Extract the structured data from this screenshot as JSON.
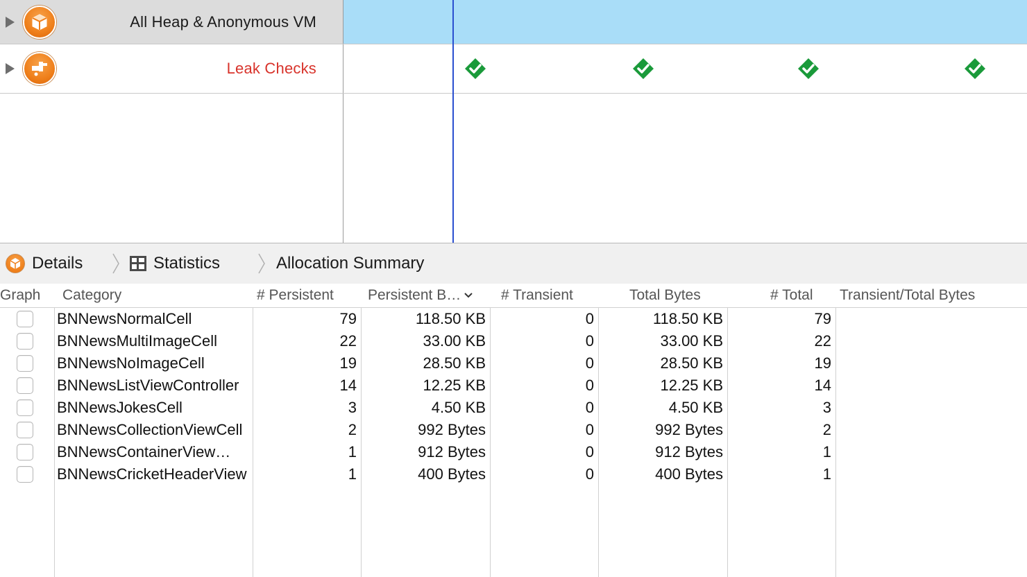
{
  "instruments": [
    {
      "name": "All Heap & Anonymous VM",
      "icon": "allocations-icon"
    },
    {
      "name": "Leak Checks",
      "icon": "leaks-icon",
      "checks": 4
    }
  ],
  "jumpbar": {
    "details": "Details",
    "statistics": "Statistics",
    "allocation_summary": "Allocation Summary"
  },
  "table": {
    "columns": {
      "graph": "Graph",
      "category": "Category",
      "persistent": "# Persistent",
      "persistent_bytes": "Persistent B…",
      "transient": "# Transient",
      "total_bytes": "Total Bytes",
      "total": "# Total",
      "transient_total_bytes": "Transient/Total Bytes"
    },
    "rows": [
      {
        "category": "BNNewsNormalCell",
        "persistent": "79",
        "persistent_bytes": "118.50 KB",
        "transient": "0",
        "total_bytes": "118.50 KB",
        "total": "79"
      },
      {
        "category": "BNNewsMultiImageCell",
        "persistent": "22",
        "persistent_bytes": "33.00 KB",
        "transient": "0",
        "total_bytes": "33.00 KB",
        "total": "22"
      },
      {
        "category": "BNNewsNoImageCell",
        "persistent": "19",
        "persistent_bytes": "28.50 KB",
        "transient": "0",
        "total_bytes": "28.50 KB",
        "total": "19"
      },
      {
        "category": "BNNewsListViewController",
        "persistent": "14",
        "persistent_bytes": "12.25 KB",
        "transient": "0",
        "total_bytes": "12.25 KB",
        "total": "14"
      },
      {
        "category": "BNNewsJokesCell",
        "persistent": "3",
        "persistent_bytes": "4.50 KB",
        "transient": "0",
        "total_bytes": "4.50 KB",
        "total": "3"
      },
      {
        "category": "BNNewsCollectionViewCell",
        "persistent": "2",
        "persistent_bytes": "992 Bytes",
        "transient": "0",
        "total_bytes": "992 Bytes",
        "total": "2"
      },
      {
        "category": "BNNewsContainerView…",
        "persistent": "1",
        "persistent_bytes": "912 Bytes",
        "transient": "0",
        "total_bytes": "912 Bytes",
        "total": "1"
      },
      {
        "category": "BNNewsCricketHeaderView",
        "persistent": "1",
        "persistent_bytes": "400 Bytes",
        "transient": "0",
        "total_bytes": "400 Bytes",
        "total": "1"
      }
    ]
  },
  "colors": {
    "track_selected": "#a9ddf8",
    "leak_label": "#d8332b",
    "check_green": "#1a9a3a",
    "playhead": "#2a4fd0",
    "instrument_orange": "#ef7f1a"
  }
}
